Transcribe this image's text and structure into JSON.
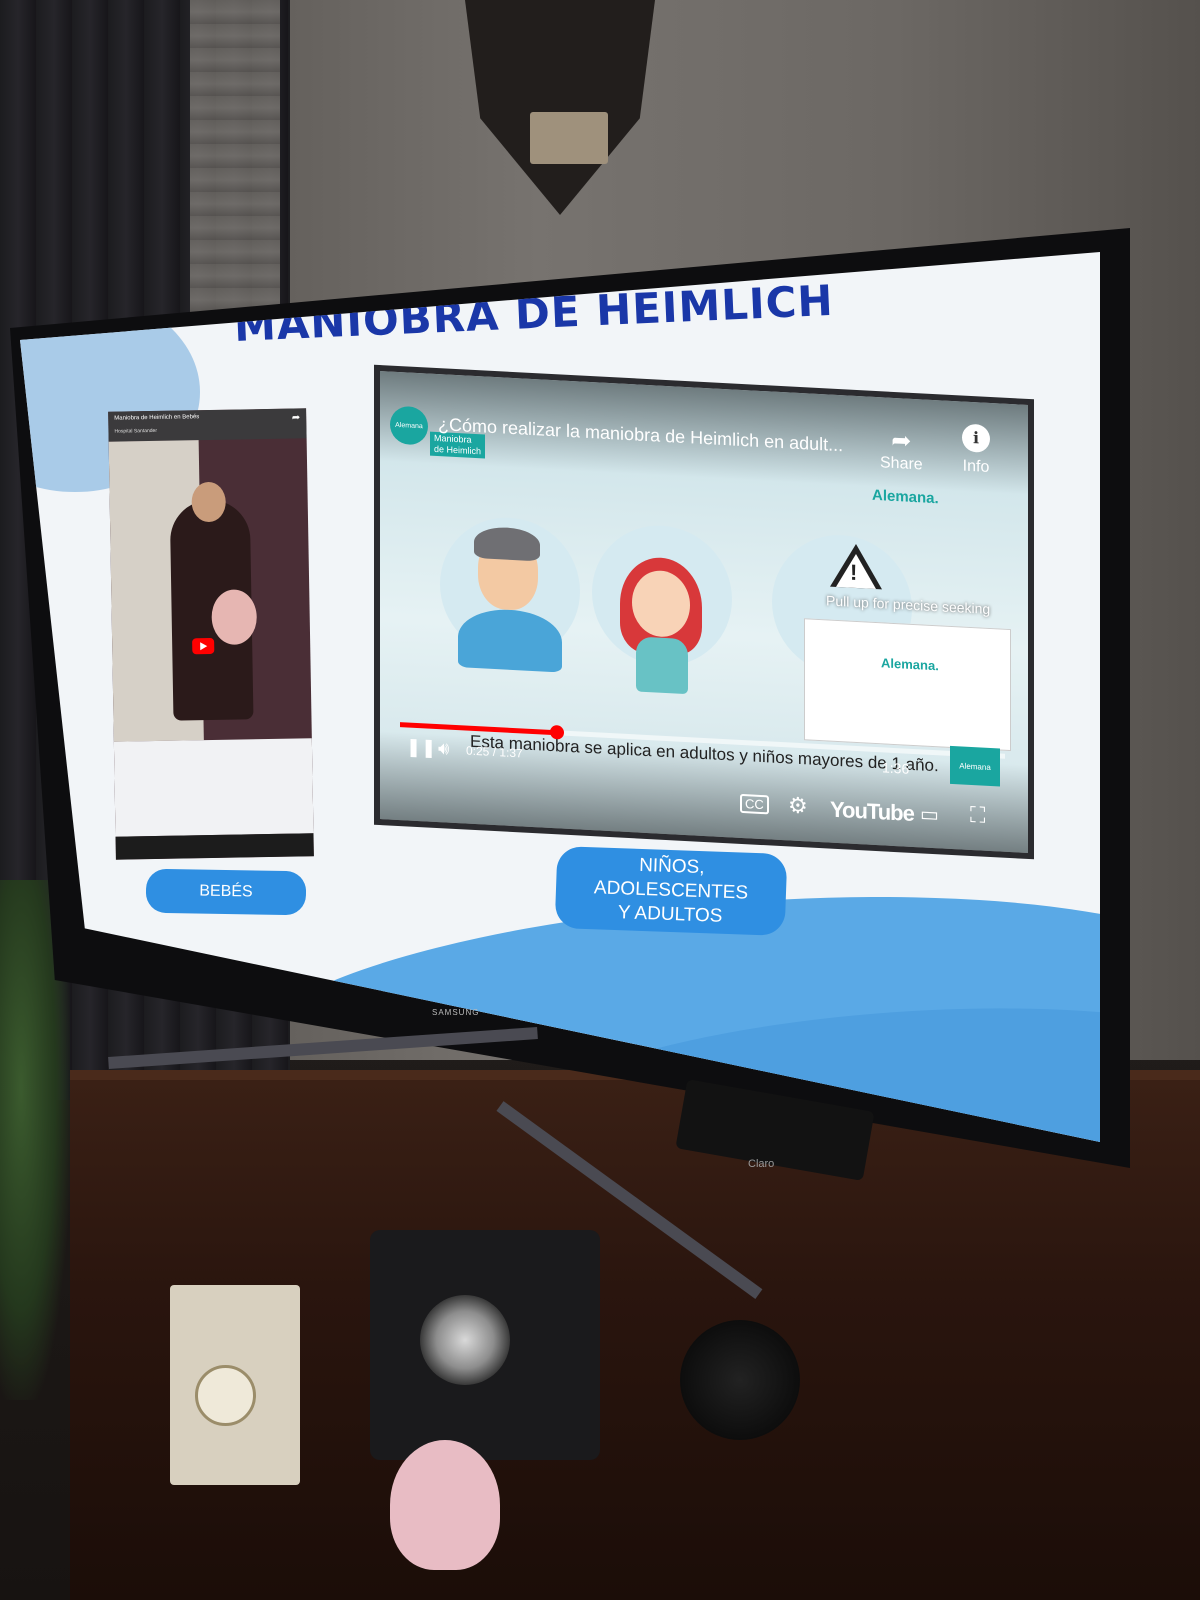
{
  "slide": {
    "title": "MANIOBRA DE HEIMLICH",
    "button_babies": "BEBÉS",
    "button_older": "NIÑOS, ADOLESCENTES\nY ADULTOS"
  },
  "small_video": {
    "title": "Maniobra de Heimlich en Bebés",
    "channel": "Hospital Santander",
    "share_icon": "share-arrow-icon",
    "play_icon": "youtube-play-icon"
  },
  "main_video": {
    "title": "¿Cómo realizar la maniobra de Heimlich en adult...",
    "logo_text": "Alemana",
    "tag_text": "Maniobra\nde Heimlich",
    "share_label": "Share",
    "info_label": "Info",
    "brand_overlay": "Alemana.",
    "seek_hint": "Pull up for precise seeking",
    "preview_brand": "Alemana.",
    "subtitle": "Esta maniobra se aplica en adultos y niños mayores de 1 año.",
    "current_time": "0:25 / 1:37",
    "preview_time": "1:36",
    "progress_fraction": 0.26,
    "youtube_label": "YouTube",
    "corner_brand": "Alemana",
    "accent": "#ff0000",
    "brand_color": "#1aa6a0"
  },
  "device": {
    "tv_brand": "SAMSUNG",
    "box_brand": "Claro"
  },
  "colors": {
    "title_blue": "#1a37a8",
    "button_blue": "#2f8fe2"
  }
}
